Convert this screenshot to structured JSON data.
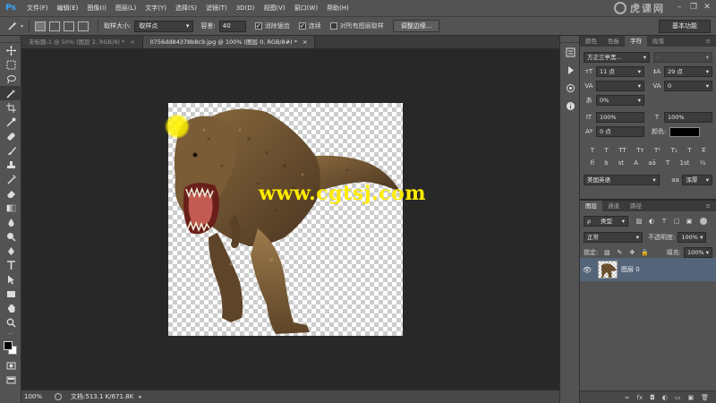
{
  "app": {
    "logo": "Ps"
  },
  "menu": [
    "文件(F)",
    "编辑(E)",
    "图像(I)",
    "图层(L)",
    "文字(Y)",
    "选择(S)",
    "滤镜(T)",
    "3D(D)",
    "视图(V)",
    "窗口(W)",
    "帮助(H)"
  ],
  "brand_watermark": "虎课网",
  "window_controls": {
    "minimize": "–",
    "restore": "❐",
    "close": "✕"
  },
  "options": {
    "sample_size_label": "取样大小:",
    "sample_size_value": "取样点",
    "tolerance_label": "容差:",
    "tolerance_value": "40",
    "antialias_label": "消除锯齿",
    "antialias_checked": true,
    "contiguous_label": "连续",
    "contiguous_checked": true,
    "sample_all_label": "对所有图层取样",
    "sample_all_checked": false,
    "refine_edge_button": "调整边缘...",
    "workspace": "基本功能"
  },
  "doc_tabs": [
    {
      "label": "未标题-1 @ 50% (图层 2, RGB/8) *",
      "close": "×",
      "active": false
    },
    {
      "label": "0756dd84378b8c9.jpg @ 100% (图层 0, RGB/8#) *",
      "close": "×",
      "active": true
    }
  ],
  "canvas_watermark": "www.cgtsj.com",
  "status": {
    "zoom": "100%",
    "doc_size": "文档:513.1 K/671.8K",
    "arrow": "▸"
  },
  "panel_top": {
    "tabs": [
      {
        "label": "颜色",
        "active": false
      },
      {
        "label": "色板",
        "active": false
      },
      {
        "label": "字符",
        "active": true
      },
      {
        "label": "段落",
        "active": false
      }
    ],
    "font_family": "方正兰亭黑...",
    "font_style": "-",
    "font_size": "11 点",
    "leading": "29 点",
    "kerning": "",
    "tracking": "0",
    "scale_pct": "0%",
    "vscale": "100%",
    "hscale": "100%",
    "baseline": "0 点",
    "color_label": "颜色:",
    "language": "美国英语",
    "antialias": "浑厚",
    "typo_buttons": [
      "T",
      "T",
      "TT",
      "Tт",
      "T¹",
      "T₁",
      "T",
      "T̶"
    ],
    "opentype_buttons": [
      "fi",
      "ꝺ",
      "st",
      "A",
      "aā",
      "T",
      "1st",
      "½"
    ]
  },
  "layers_panel": {
    "tabs": [
      {
        "label": "图层",
        "active": true
      },
      {
        "label": "通道",
        "active": false
      },
      {
        "label": "路径",
        "active": false
      }
    ],
    "filter_kind": "类型",
    "blend_mode": "正常",
    "opacity_label": "不透明度:",
    "opacity_value": "100%",
    "lock_label": "锁定:",
    "fill_label": "填充:",
    "fill_value": "100%",
    "layers": [
      {
        "name": "图层 0",
        "visible": true,
        "selected": true
      }
    ],
    "bottom_icons": [
      "∞",
      "fx",
      "◘",
      "◐",
      "▭",
      "▣",
      "🗑"
    ]
  },
  "colors": {
    "accent_selected_layer": "#54657a",
    "watermark_yellow": "#ffec00",
    "ps_blue": "#3aa6ff"
  }
}
